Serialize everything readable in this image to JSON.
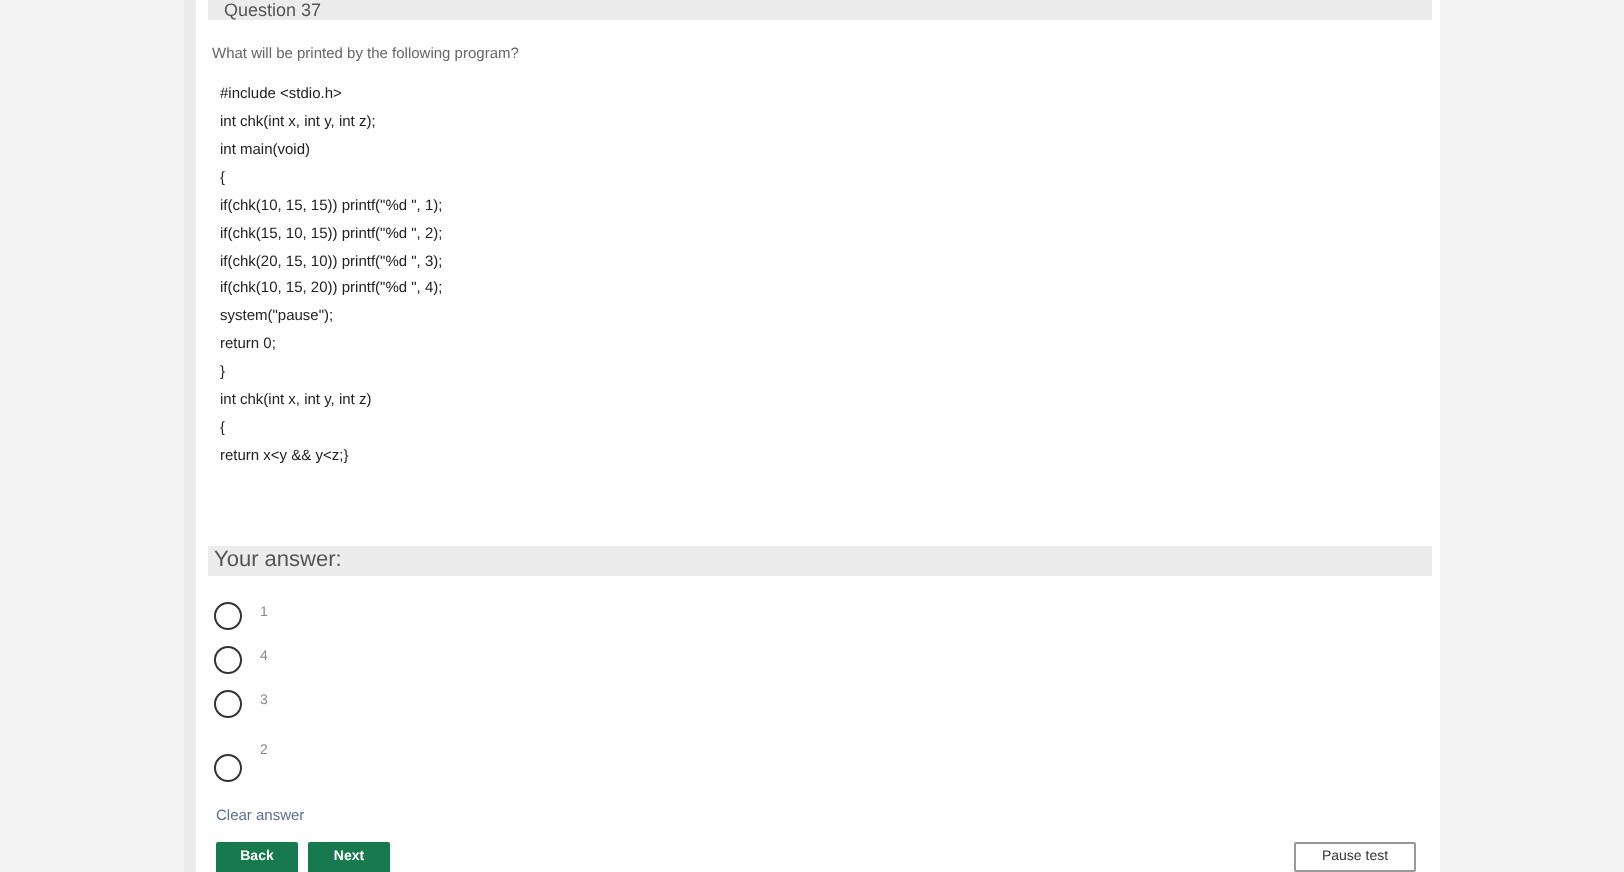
{
  "question": {
    "title": "Question 37",
    "prompt": "What will be printed by the following program?",
    "code": [
      "#include <stdio.h>",
      "int chk(int x, int y, int z);",
      "int main(void)",
      "{",
      "if(chk(10, 15, 15)) printf(\"%d \", 1);",
      "if(chk(15, 10, 15)) printf(\"%d \", 2);",
      "if(chk(20, 15, 10)) printf(\"%d \", 3);",
      "if(chk(10, 15, 20)) printf(\"%d \", 4);",
      "system(\"pause\");",
      "return 0;",
      "}",
      "int chk(int x, int y, int z)",
      "{",
      "return x<y && y<z;}"
    ]
  },
  "answer": {
    "heading": "Your answer:",
    "options": [
      {
        "label": "1",
        "selected": false
      },
      {
        "label": "4",
        "selected": false
      },
      {
        "label": "3",
        "selected": false
      },
      {
        "label": "2",
        "selected": false
      }
    ],
    "clear": "Clear answer"
  },
  "buttons": {
    "back": "Back",
    "next": "Next",
    "pause": "Pause test"
  }
}
